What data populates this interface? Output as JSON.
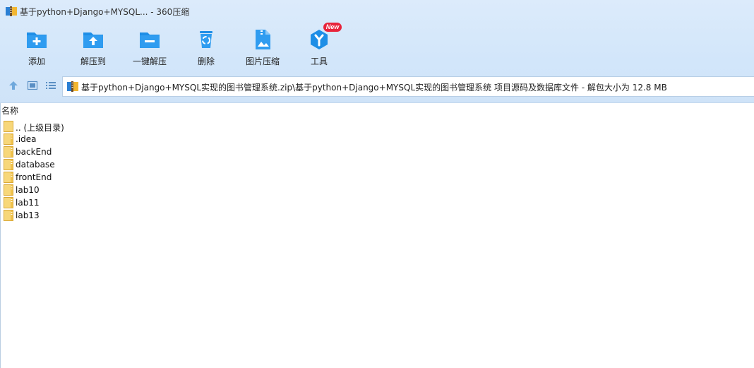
{
  "window": {
    "title": "基于python+Django+MYSQL... - 360压缩"
  },
  "toolbar": {
    "items": [
      {
        "label": "添加",
        "icon": "add-folder-icon"
      },
      {
        "label": "解压到",
        "icon": "extract-to-icon"
      },
      {
        "label": "一键解压",
        "icon": "one-click-extract-icon"
      },
      {
        "label": "删除",
        "icon": "delete-recycle-icon"
      },
      {
        "label": "图片压缩",
        "icon": "image-compress-icon"
      },
      {
        "label": "工具",
        "icon": "tools-icon",
        "badge": "New"
      }
    ]
  },
  "navbar": {
    "path": "基于python+Django+MYSQL实现的图书管理系统.zip\\基于python+Django+MYSQL实现的图书管理系统 项目源码及数据库文件 - 解包大小为 12.8 MB"
  },
  "filelist": {
    "column_name": "名称",
    "items": [
      {
        "name": ".. (上级目录)",
        "icon": "parent-folder-icon"
      },
      {
        "name": ".idea",
        "icon": "folder-icon"
      },
      {
        "name": "backEnd",
        "icon": "folder-icon"
      },
      {
        "name": "database",
        "icon": "folder-icon"
      },
      {
        "name": "frontEnd",
        "icon": "folder-icon"
      },
      {
        "name": "lab10",
        "icon": "folder-icon"
      },
      {
        "name": "lab11",
        "icon": "folder-icon"
      },
      {
        "name": "lab13",
        "icon": "folder-icon"
      }
    ]
  },
  "colors": {
    "accent": "#1e8ee6",
    "header_bg": "#d4e7fa",
    "folder": "#f5c94d",
    "badge": "#e8243b"
  }
}
